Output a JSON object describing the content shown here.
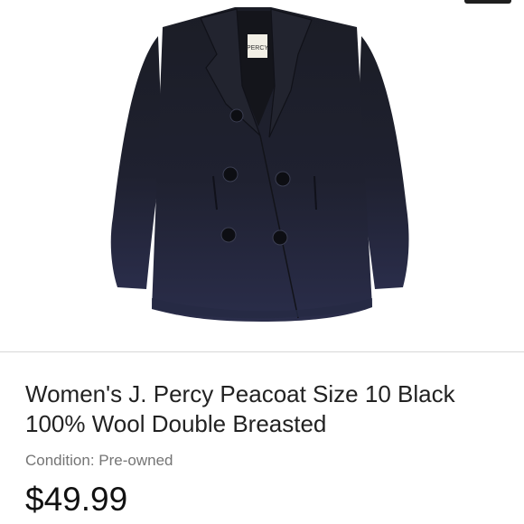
{
  "listing": {
    "photo": {
      "subject": "black-peacoat-photo",
      "label_text": "PERCY"
    },
    "title": "Women's J. Percy Peacoat Size 10 Black 100% Wool Double Breasted",
    "condition": "Condition: Pre-owned",
    "price": "$49.99"
  },
  "colors": {
    "coat": "#1b1d27",
    "coat_shadow": "#262a44",
    "background": "#ffffff",
    "divider": "#d8d8d8",
    "price": "#111111",
    "condition": "#757575"
  }
}
